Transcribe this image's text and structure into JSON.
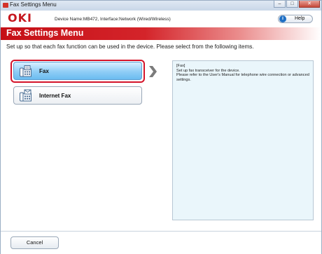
{
  "window": {
    "title": "Fax Settings Menu",
    "minimize_glyph": "–",
    "maximize_glyph": "□",
    "close_glyph": "✕"
  },
  "header": {
    "logo": "OKI",
    "device_label": "Device Name:MB472, Interface:Network (Wired/Wireless)",
    "help_label": "Help",
    "help_icon_glyph": "i"
  },
  "banner": {
    "title": "Fax Settings Menu"
  },
  "intro_text": "Set up so that each fax function can be used in the device. Please select from the following items.",
  "options": [
    {
      "label": "Fax",
      "icon": "fax-icon",
      "selected": true
    },
    {
      "label": "Internet Fax",
      "icon": "internet-fax-icon",
      "selected": false
    }
  ],
  "description": {
    "lines": [
      "[Fax]",
      "Set up fax transceiver for the device.",
      "Please refer to the User's Manual for telephone wire connection or advanced settings."
    ]
  },
  "footer": {
    "cancel_label": "Cancel"
  },
  "colors": {
    "accent": "#c6171e",
    "selection": "#d4142a",
    "selected_fill": "#8fcdf6",
    "description_bg": "#eaf6fb"
  }
}
